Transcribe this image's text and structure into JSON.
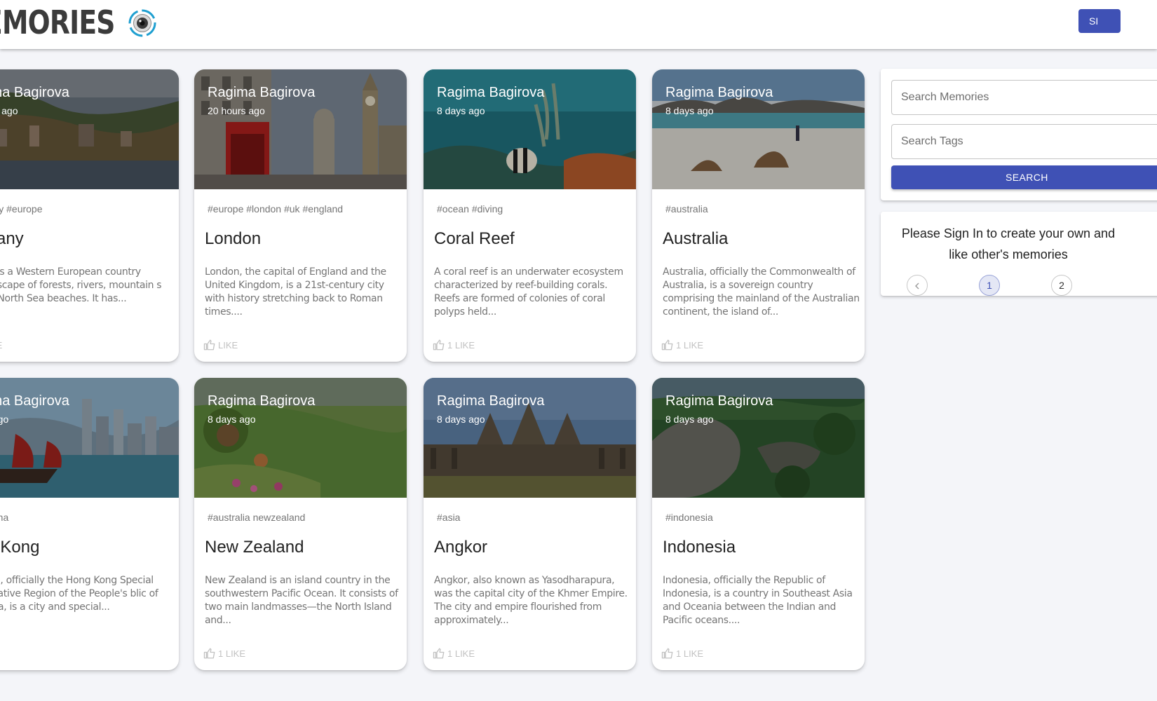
{
  "header": {
    "brand": "EMORIES",
    "signin_label": "SI"
  },
  "cards": [
    {
      "author": "gima Bagirova",
      "time": "ours ago",
      "tags": "many #europe",
      "title": "rmany",
      "description": "any is a Western European country landscape of forests, rivers, mountain s and North Sea beaches. It has...",
      "like": "KE"
    },
    {
      "author": "Ragima Bagirova",
      "time": "20 hours ago",
      "tags": "#europe #london #uk #england",
      "title": "London",
      "description": "London, the capital of England and the United Kingdom, is a 21st-century city with history stretching back to Roman times....",
      "like": "LIKE"
    },
    {
      "author": "Ragima Bagirova",
      "time": "8 days ago",
      "tags": "#ocean #diving",
      "title": "Coral Reef",
      "description": "A coral reef is an underwater ecosystem characterized by reef-building corals. Reefs are formed of colonies of coral polyps held...",
      "like": "1 LIKE"
    },
    {
      "author": "Ragima Bagirova",
      "time": "8 days ago",
      "tags": "#australia",
      "title": "Australia",
      "description": "Australia, officially the Commonwealth of Australia, is a sovereign country comprising the mainland of the Australian continent, the island of...",
      "like": "1 LIKE"
    },
    {
      "author": "gima Bagirova",
      "time": "ys ago",
      "tags": "#china",
      "title": "ng Kong",
      "description": "Kong, officially the Hong Kong Special nistrative Region of the People's blic of China, is a city and special...",
      "like": "E"
    },
    {
      "author": "Ragima Bagirova",
      "time": "8 days ago",
      "tags": "#australia newzealand",
      "title": "New Zealand",
      "description": "New Zealand is an island country in the southwestern Pacific Ocean. It consists of two main landmasses—the North Island and...",
      "like": "1 LIKE"
    },
    {
      "author": "Ragima Bagirova",
      "time": "8 days ago",
      "tags": "#asia",
      "title": "Angkor",
      "description": "Angkor, also known as Yasodharapura, was the capital city of the Khmer Empire. The city and empire flourished from approximately...",
      "like": "1 LIKE"
    },
    {
      "author": "Ragima Bagirova",
      "time": "8 days ago",
      "tags": "#indonesia",
      "title": "Indonesia",
      "description": "Indonesia, officially the Republic of Indonesia, is a country in Southeast Asia and Oceania between the Indian and Pacific oceans....",
      "like": "1 LIKE"
    }
  ],
  "sidebar": {
    "search_memories_placeholder": "Search Memories",
    "search_tags_placeholder": "Search Tags",
    "search_label": "SEARCH",
    "notice": "Please Sign In to create your own and like other's memories",
    "pagination": {
      "prev_icon": "chevron-left-icon",
      "pages": [
        "1",
        "2"
      ],
      "current": "1"
    }
  },
  "colors": {
    "primary": "#3f51b5",
    "background": "#f4f5f9"
  }
}
